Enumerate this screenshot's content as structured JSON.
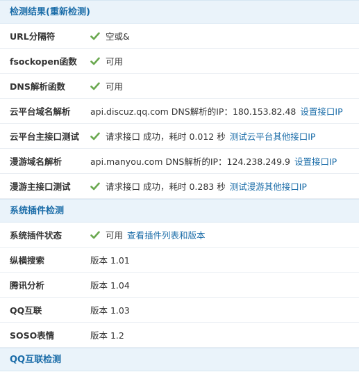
{
  "colors": {
    "accent": "#1a6ca8",
    "check": "#6aa84f",
    "header_bg": "#eaf3fa"
  },
  "sections": {
    "result": {
      "title": "检测结果(",
      "recheck": "重新检测",
      "close": ")"
    },
    "plugins": {
      "title": "系统插件检测"
    },
    "qq": {
      "title": "QQ互联检测"
    }
  },
  "rows": {
    "url_sep": {
      "label": "URL分隔符",
      "value": "空或&"
    },
    "fsockopen": {
      "label": "fsockopen函数",
      "value": "可用"
    },
    "dns": {
      "label": "DNS解析函数",
      "value": "可用"
    },
    "cloud_dns": {
      "label": "云平台域名解析",
      "value": "api.discuz.qq.com DNS解析的IP：180.153.82.48",
      "link": "设置接口IP"
    },
    "cloud_api": {
      "label": "云平台主接口测试",
      "value": "请求接口 成功，耗时 0.012 秒",
      "link": "测试云平台其他接口IP"
    },
    "manyou_dns": {
      "label": "漫游域名解析",
      "value": "api.manyou.com DNS解析的IP：124.238.249.9",
      "link": "设置接口IP"
    },
    "manyou_api": {
      "label": "漫游主接口测试",
      "value": "请求接口 成功，耗时 0.283 秒",
      "link": "测试漫游其他接口IP"
    },
    "plugin_status": {
      "label": "系统插件状态",
      "value": "可用",
      "link": "查看插件列表和版本"
    },
    "zongheng": {
      "label": "纵横搜索",
      "value": "版本 1.01"
    },
    "tencent": {
      "label": "腾讯分析",
      "value": "版本 1.04"
    },
    "qqconnect": {
      "label": "QQ互联",
      "value": "版本 1.03"
    },
    "soso": {
      "label": "SOSO表情",
      "value": "版本 1.2"
    }
  }
}
